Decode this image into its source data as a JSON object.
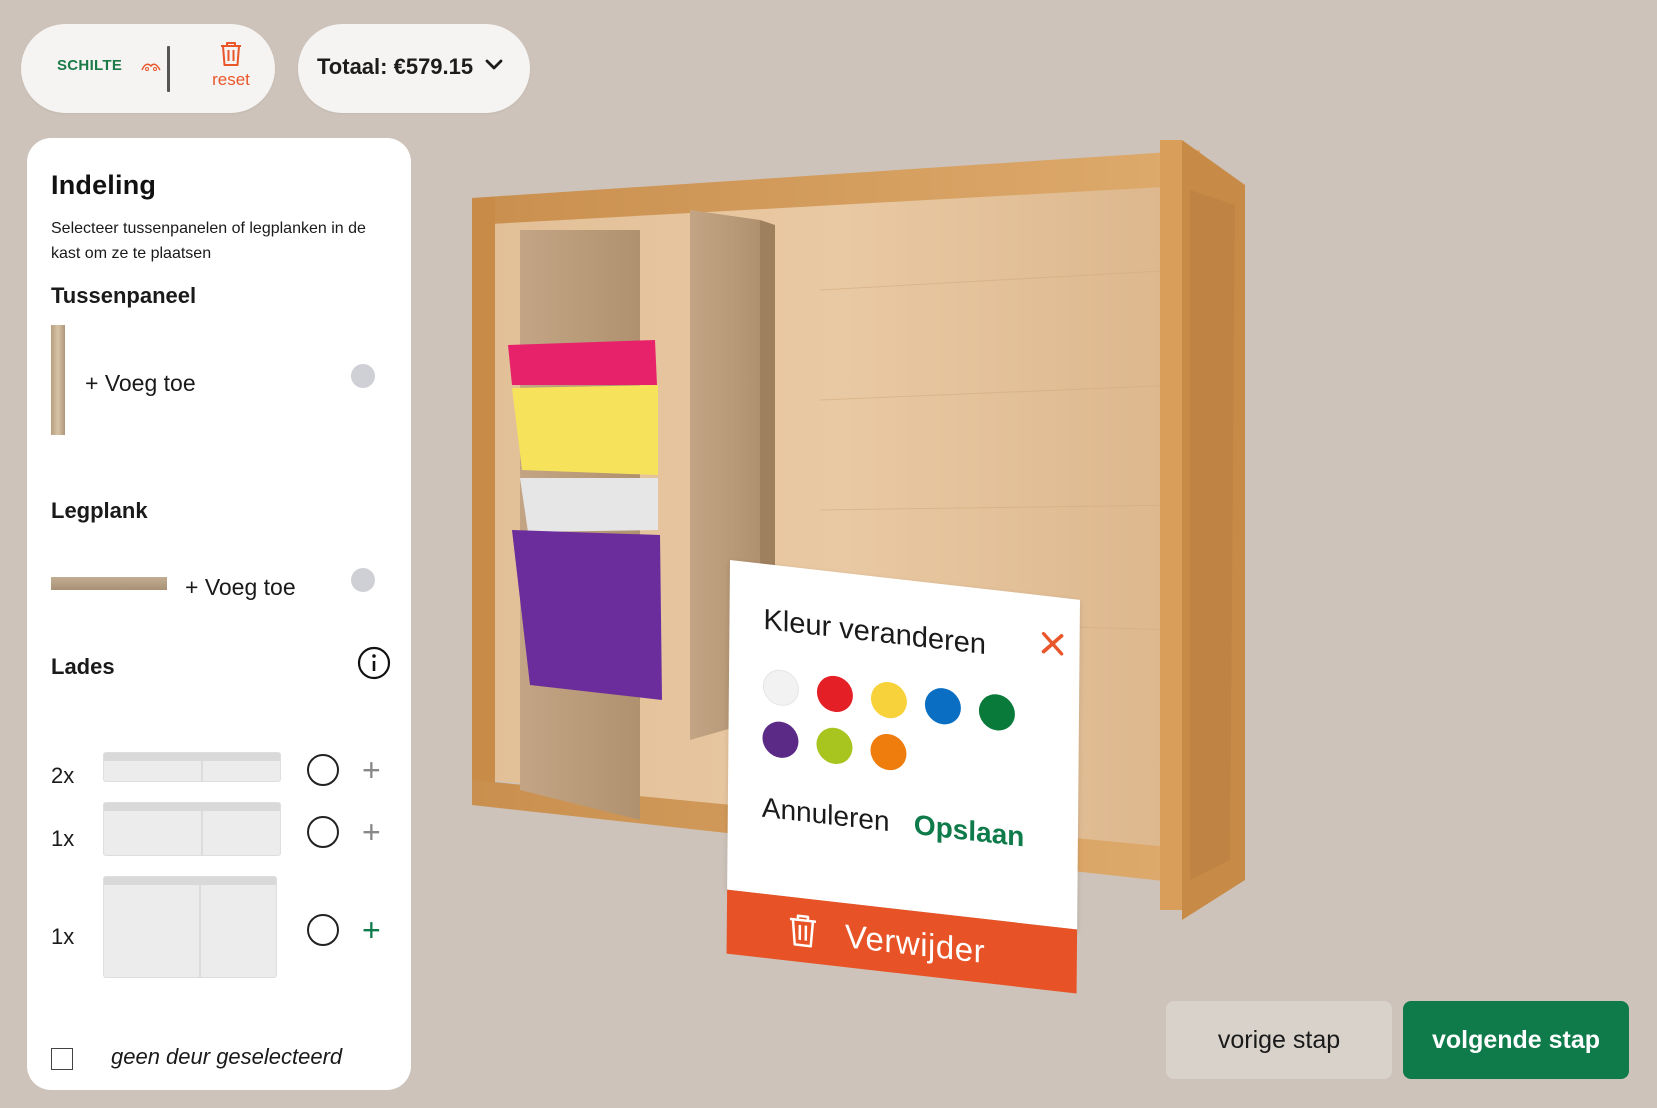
{
  "header": {
    "logo_text": "SCHILTE",
    "reset_label": "reset",
    "total_label": "Totaal: €579.15"
  },
  "panel": {
    "title": "Indeling",
    "description": "Selecteer tussenpanelen of legplanken in de kast om ze te plaatsen",
    "tussenpaneel": {
      "title": "Tussenpaneel",
      "add_label": "+ Voeg toe"
    },
    "legplank": {
      "title": "Legplank",
      "add_label": "+ Voeg toe"
    },
    "lades": {
      "title": "Lades",
      "items": [
        {
          "qty": "2x",
          "plus": "+"
        },
        {
          "qty": "1x",
          "plus": "+"
        },
        {
          "qty": "1x",
          "plus": "+"
        }
      ]
    },
    "door_label": "geen deur geselecteerd"
  },
  "color_popup": {
    "title": "Kleur veranderen",
    "swatches": [
      {
        "name": "white",
        "color": "#f2f2f2"
      },
      {
        "name": "red",
        "color": "#e41f26"
      },
      {
        "name": "yellow",
        "color": "#f8d23a"
      },
      {
        "name": "blue",
        "color": "#0a6fc2"
      },
      {
        "name": "green",
        "color": "#0a7a3a"
      },
      {
        "name": "purple",
        "color": "#5a2a86"
      },
      {
        "name": "lime",
        "color": "#a7c41f"
      },
      {
        "name": "orange",
        "color": "#ef7d0d"
      }
    ],
    "cancel_label": "Annuleren",
    "save_label": "Opslaan",
    "delete_label": "Verwijder"
  },
  "nav": {
    "prev_label": "vorige stap",
    "next_label": "volgende stap"
  },
  "colors": {
    "brand_green": "#0f7a4a",
    "accent_orange": "#e75326",
    "background": "#cdc3ba"
  }
}
